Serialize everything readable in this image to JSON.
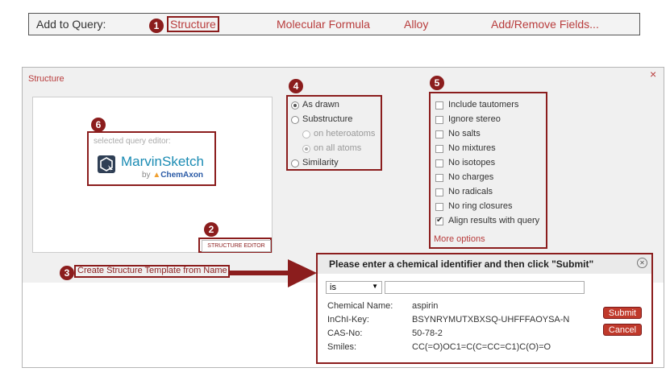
{
  "query_bar": {
    "label": "Add to Query:",
    "links": [
      "Structure",
      "Molecular Formula",
      "Alloy",
      "Add/Remove Fields..."
    ]
  },
  "panel": {
    "title": "Structure",
    "close_glyph": "×"
  },
  "editor_preview": {
    "selected_label": "selected query editor:",
    "product_name": "MarvinSketch",
    "by": "by",
    "vendor": "ChemAxon",
    "editor_button": "STRUCTURE EDITOR"
  },
  "search_type": {
    "options": [
      "As drawn",
      "Substructure",
      "on heteroatoms",
      "on all atoms",
      "Similarity"
    ],
    "selected": "As drawn"
  },
  "filters": {
    "options": [
      "Include tautomers",
      "Ignore stereo",
      "No salts",
      "No mixtures",
      "No isotopes",
      "No charges",
      "No radicals",
      "No ring closures",
      "Align results with query"
    ],
    "checked": [
      "Align results with query"
    ],
    "more_options": "More options"
  },
  "template_link": "Create Structure Template from Name",
  "callouts": [
    "1",
    "2",
    "3",
    "4",
    "5",
    "6"
  ],
  "identifier_dialog": {
    "title": "Please enter a chemical identifier and then click \"Submit\"",
    "select_value": "is",
    "input_value": "",
    "rows": [
      {
        "label": "Chemical Name:",
        "value": "aspirin"
      },
      {
        "label": "InChI-Key:",
        "value": "BSYNRYMUTXBXSQ-UHFFFAOYSA-N"
      },
      {
        "label": "CAS-No:",
        "value": "50-78-2"
      },
      {
        "label": "Smiles:",
        "value": "CC(=O)OC1=C(C=CC=C1)C(O)=O"
      }
    ],
    "submit_label": "Submit",
    "cancel_label": "Cancel"
  },
  "colors": {
    "accent": "#b83c3c",
    "callout": "#8b1d1d",
    "panel_bg": "#f0f0f0"
  }
}
